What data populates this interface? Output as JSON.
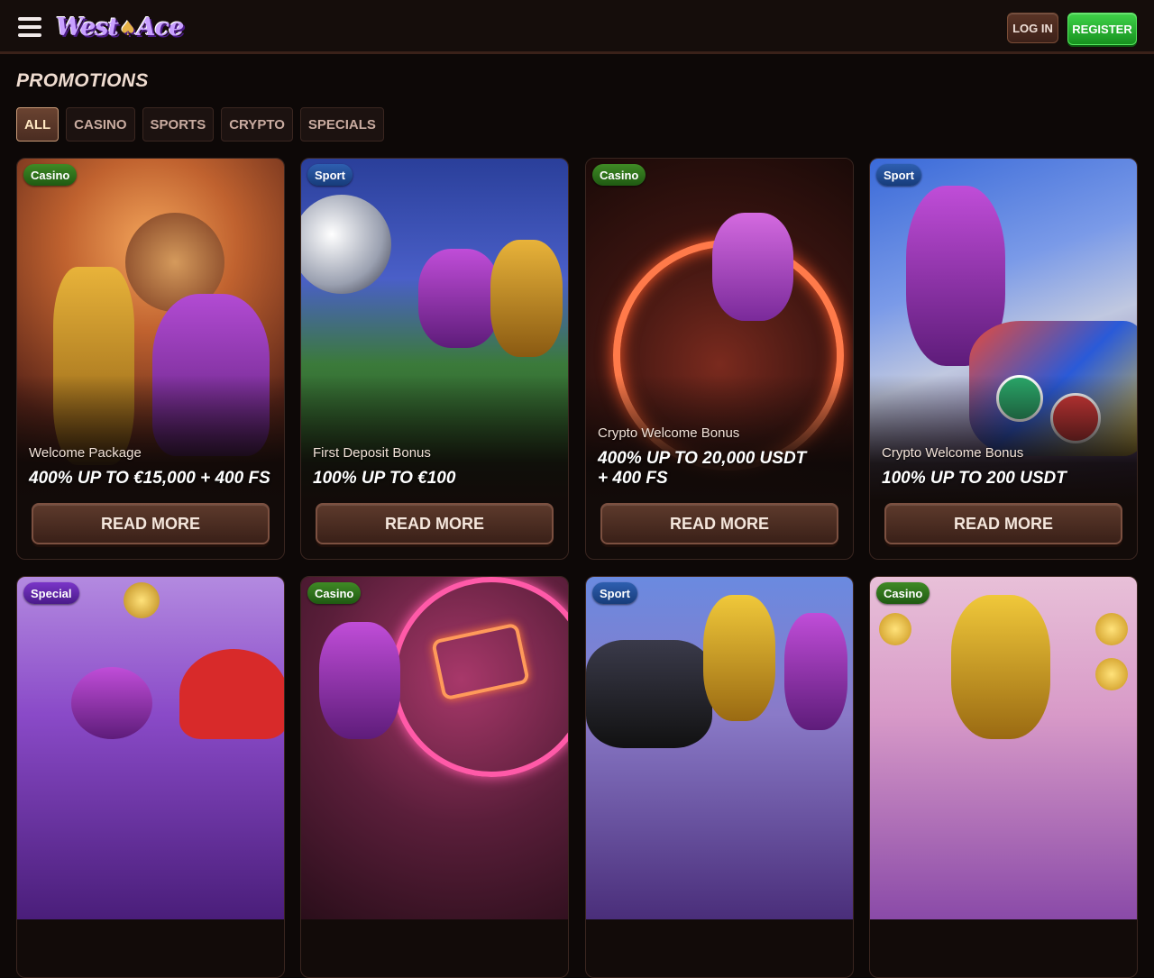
{
  "header": {
    "logo_text": "West Ace",
    "login_label": "LOG IN",
    "register_label": "REGISTER"
  },
  "page": {
    "title": "PROMOTIONS"
  },
  "filters": [
    {
      "label": "ALL",
      "active": true
    },
    {
      "label": "CASINO",
      "active": false
    },
    {
      "label": "SPORTS",
      "active": false
    },
    {
      "label": "CRYPTO",
      "active": false
    },
    {
      "label": "SPECIALS",
      "active": false
    }
  ],
  "cards": [
    {
      "tag": "Casino",
      "subtitle": "Welcome Package",
      "title": "400% UP TO €15,000 + 400 FS",
      "button": "READ MORE"
    },
    {
      "tag": "Sport",
      "subtitle": "First Deposit Bonus",
      "title": "100% UP TO €100",
      "button": "READ MORE"
    },
    {
      "tag": "Casino",
      "subtitle": "Crypto Welcome Bonus",
      "title": "400% UP TO 20,000 USDT + 400 FS",
      "button": "READ MORE"
    },
    {
      "tag": "Sport",
      "subtitle": "Crypto Welcome Bonus",
      "title": "100% UP TO 200 USDT",
      "button": "READ MORE"
    },
    {
      "tag": "Special"
    },
    {
      "tag": "Casino"
    },
    {
      "tag": "Sport"
    },
    {
      "tag": "Casino"
    }
  ],
  "colors": {
    "background": "#0d0807",
    "register_green": "#2bb534",
    "casino_tag": "#2f7a1c",
    "sport_tag": "#234d95",
    "special_tag": "#6227a8"
  }
}
